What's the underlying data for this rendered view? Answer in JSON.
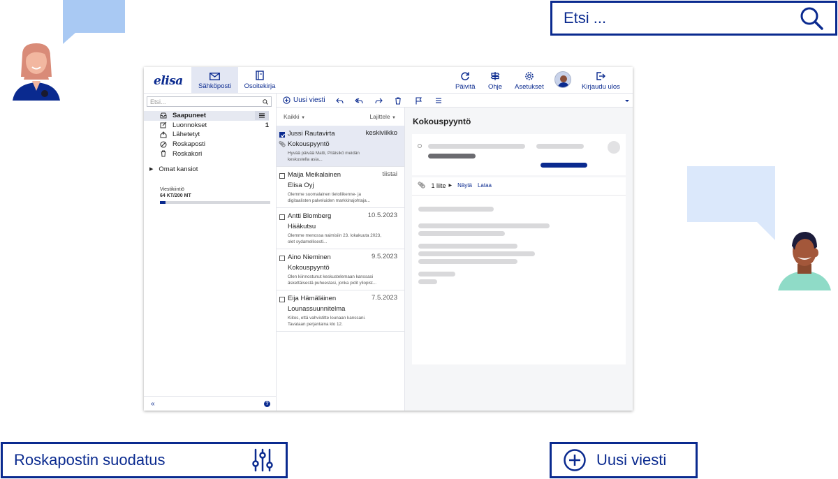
{
  "callouts": {
    "search": "Etsi ...",
    "spam_filter": "Roskapostin suodatus",
    "new_message": "Uusi viesti"
  },
  "topnav": {
    "mail_tab": "Sähköposti",
    "contacts_tab": "Osoitekirja",
    "refresh": "Päivitä",
    "help": "Ohje",
    "settings": "Asetukset",
    "logout": "Kirjaudu ulos"
  },
  "sidebar": {
    "search_placeholder": "Etsi...",
    "folders": [
      {
        "label": "Saapuneet",
        "icon": "inbox-icon"
      },
      {
        "label": "Luonnokset",
        "icon": "draft-icon",
        "count": "1"
      },
      {
        "label": "Lähetetyt",
        "icon": "sent-icon"
      },
      {
        "label": "Roskaposti",
        "icon": "spam-icon"
      },
      {
        "label": "Roskakori",
        "icon": "trash-icon"
      }
    ],
    "my_folders": "Omat kansiot",
    "quota_label": "Viestikiintiö",
    "quota_value": "64 KT/200 MT",
    "quota_fraction": 0.05
  },
  "toolbar": {
    "new_message": "Uusi viesti"
  },
  "list": {
    "filter": "Kaikki",
    "sort": "Lajittele",
    "messages": [
      {
        "from": "Jussi Rautavirta",
        "date": "keskiviikko",
        "subject": "Kokouspyyntö",
        "preview": "Hyvää päivää Matti, Pitäisikö meidän keskustella asia...",
        "selected": true,
        "attachment": true
      },
      {
        "from": "Maija Meikalainen",
        "date": "tiistai",
        "subject": "Elisa Oyj",
        "preview": "Olemme suomalainen tietoliikenne- ja digitaalisten palveluiden markkinajohtaja..."
      },
      {
        "from": "Antti Blomberg",
        "date": "10.5.2023",
        "subject": "Hääkutsu",
        "preview": "Olemme menossa naimisiin 23. lokakuuta 2023, olet sydamellisesti..."
      },
      {
        "from": "Aino Nieminen",
        "date": "9.5.2023",
        "subject": "Kokouspyyntö",
        "preview": "Olen kiinnostunut keskustelemaan kanssasi äskettäisestä puheestasi, jonka pidit yliopist..."
      },
      {
        "from": "Eija Hämäläinen",
        "date": "7.5.2023",
        "subject": "Lounassuunnitelma",
        "preview": "Kiitos, että vahvistitte lounaan kanssani. Tavataan perjantaina klo 12."
      }
    ]
  },
  "reader": {
    "title": "Kokouspyyntö",
    "attachment_count": "1 liite",
    "view": "Näytä",
    "download": "Lataa"
  }
}
